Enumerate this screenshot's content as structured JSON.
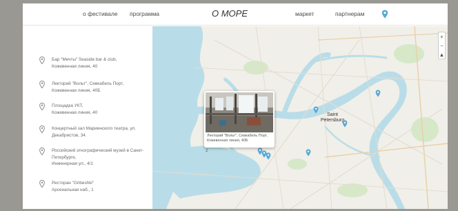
{
  "nav": {
    "items_left": [
      "о фестивале",
      "программа"
    ],
    "brand": "О МОРЕ",
    "items_right": [
      "маркет",
      "партнерам"
    ],
    "accent": "#5aa9d6"
  },
  "locations": [
    {
      "name": "Бар \"Мечты\" Seaside bar & club,",
      "address": "Кожевенная линия, 40"
    },
    {
      "name": "Лекторий \"Вольт\", Севкабель Порт,",
      "address": "Кожевенная линия, 40Б"
    },
    {
      "name": "Площадка УКТ,",
      "address": "Кожевенная линия, 40"
    },
    {
      "name": "Концертный зал Мариинского театра, ул. Декабристов, 34.",
      "address": ""
    },
    {
      "name": "Российский этнографический музей в Санкт-Петербурге,",
      "address": "Инженерная ул., 4/1"
    },
    {
      "name": "Ресторан \"Gribeshki\"",
      "address": "Арсенальная наб., 1"
    }
  ],
  "map": {
    "zoom_in": "+",
    "zoom_out": "−",
    "compass": "▲",
    "city_label": "Saint\nPetersburg",
    "popup_caption": "Лекторий \"Вольт\", Севкабель Порт, Кожевенная линия, 40Б",
    "popup_index": "2",
    "water_color": "#b9dde8",
    "land_color": "#f1efe9",
    "park_color": "#d6e8c8",
    "pin_color": "#5aa9d6"
  }
}
